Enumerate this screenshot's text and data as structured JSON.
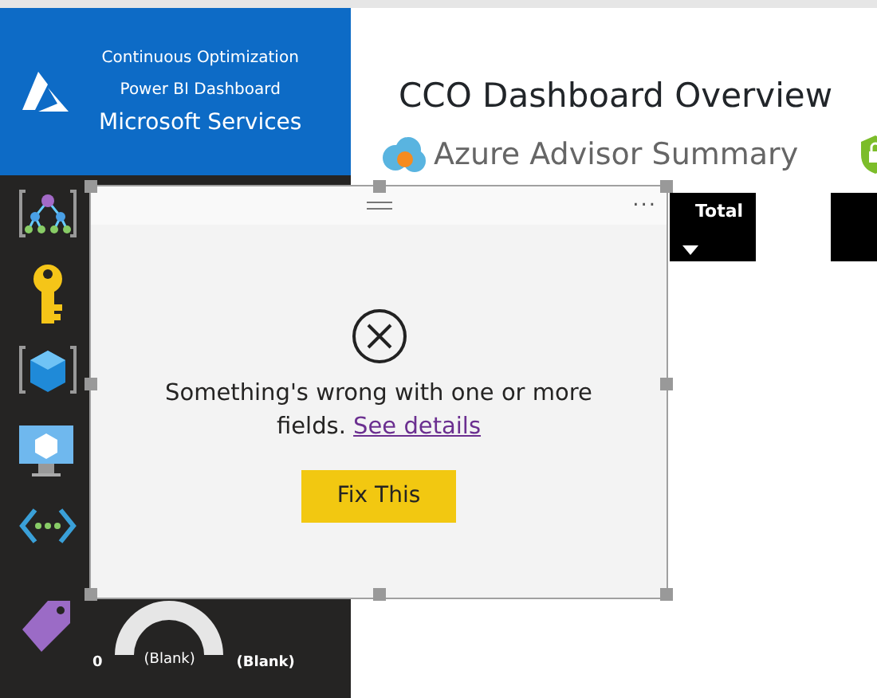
{
  "sidebar": {
    "header_lines": [
      "Continuous Optimization",
      "Power BI Dashboard"
    ],
    "brand": "Microsoft Services",
    "rows": [
      {
        "kind": "icon"
      },
      {
        "kind": "icon"
      },
      {
        "kind": "icon"
      },
      {
        "kind": "icon"
      },
      {
        "kind": "icon"
      },
      {
        "kind": "gauge",
        "min": "0",
        "center": "(Blank)",
        "value": "(Blank)"
      }
    ]
  },
  "main": {
    "title": "CCO Dashboard Overview",
    "section": "Azure Advisor Summary",
    "column_header": "Total"
  },
  "dialog": {
    "message": "Something's wrong with one or more fields.",
    "link": "See details",
    "button": "Fix This",
    "menu": "..."
  }
}
